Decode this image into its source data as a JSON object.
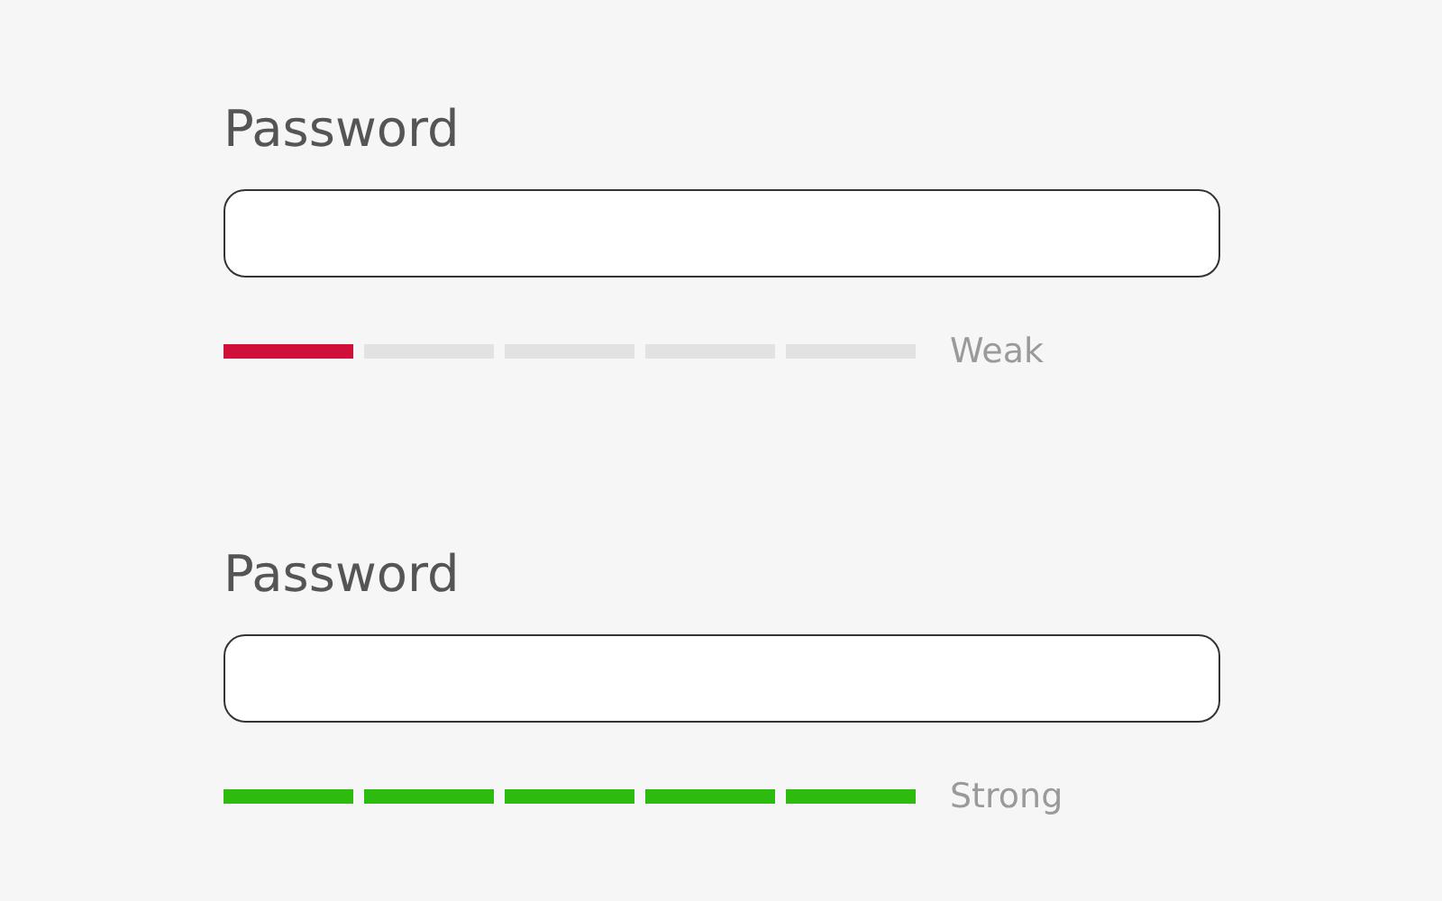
{
  "fields": [
    {
      "label": "Password",
      "strength": {
        "kind": "weak",
        "text": "Weak",
        "segments": [
          {
            "on": true
          },
          {
            "on": false
          },
          {
            "on": false
          },
          {
            "on": false
          },
          {
            "on": false
          }
        ]
      }
    },
    {
      "label": "Password",
      "strength": {
        "kind": "strong",
        "text": "Strong",
        "segments": [
          {
            "on": true
          },
          {
            "on": true
          },
          {
            "on": true
          },
          {
            "on": true
          },
          {
            "on": true
          }
        ]
      }
    }
  ]
}
